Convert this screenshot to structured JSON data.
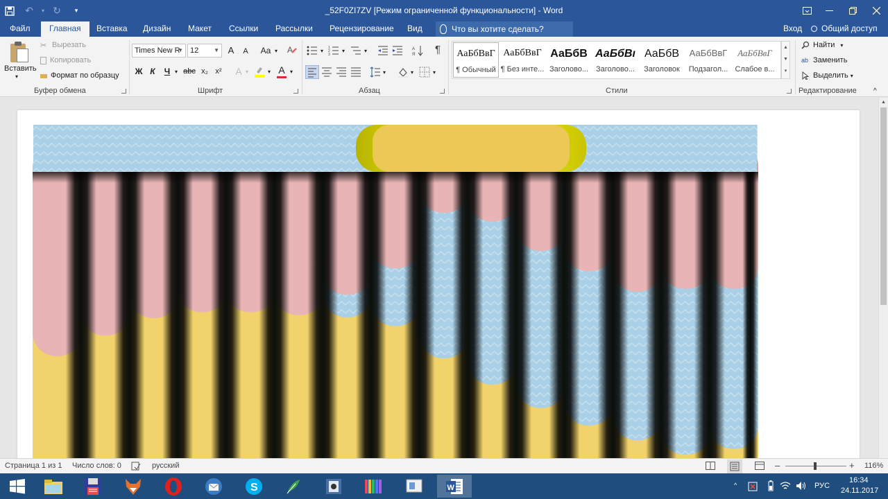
{
  "window": {
    "title": "_52F0ZI7ZV [Режим ограниченной функциональности] - Word"
  },
  "tabs": {
    "file": "Файл",
    "home": "Главная",
    "insert": "Вставка",
    "design": "Дизайн",
    "layout": "Макет",
    "references": "Ссылки",
    "mailings": "Рассылки",
    "review": "Рецензирование",
    "view": "Вид",
    "tell_me": "Что вы хотите сделать?",
    "signin": "Вход",
    "share": "Общий доступ"
  },
  "clipboard": {
    "paste": "Вставить",
    "cut": "Вырезать",
    "copy": "Копировать",
    "format_painter": "Формат по образцу",
    "label": "Буфер обмена"
  },
  "font": {
    "name": "Times New R",
    "size": "12",
    "bold": "Ж",
    "italic": "К",
    "underline": "Ч",
    "strike": "abc",
    "subscript": "x₂",
    "superscript": "x²",
    "grow": "A",
    "shrink": "A",
    "change_case": "Aa",
    "font_color_glyph": "A",
    "effects_glyph": "A",
    "label": "Шрифт"
  },
  "paragraph": {
    "label": "Абзац",
    "pilcrow": "¶"
  },
  "styles": {
    "label": "Стили",
    "items": [
      {
        "sample": "АаБбВвГ",
        "name": "¶ Обычный"
      },
      {
        "sample": "АаБбВвГ",
        "name": "¶ Без инте..."
      },
      {
        "sample": "АаБбВ",
        "name": "Заголово..."
      },
      {
        "sample": "АаБбВı",
        "name": "Заголово..."
      },
      {
        "sample": "АаБбВ",
        "name": "Заголовок"
      },
      {
        "sample": "АаБбВвГ",
        "name": "Подзагол..."
      },
      {
        "sample": "АаБбВвГ",
        "name": "Слабое в..."
      }
    ]
  },
  "editing": {
    "find": "Найти",
    "replace": "Заменить",
    "select": "Выделить",
    "label": "Редактирование"
  },
  "status": {
    "page": "Страница 1 из 1",
    "words": "Число слов: 0",
    "language": "русский",
    "zoom": "116%"
  },
  "tray": {
    "lang": "РУС",
    "time": "16:34",
    "date": "24.11.2017"
  },
  "colors": {
    "word_blue": "#2b579a",
    "stripe_pink": "#e8b4b5",
    "stripe_blue": "#a9d0e6",
    "stripe_yellow": "#f2d26b",
    "plaque_yellow": "#ecc957"
  },
  "artwork": {
    "columns": [
      {
        "pink_end": 0.63,
        "blue_end": 0.63
      },
      {
        "pink_end": 0.56,
        "blue_end": 0.56
      },
      {
        "pink_end": 0.5,
        "blue_end": 0.5
      },
      {
        "pink_end": 0.48,
        "blue_end": 0.48
      },
      {
        "pink_end": 0.48,
        "blue_end": 0.48
      },
      {
        "pink_end": 0.49,
        "blue_end": 0.49
      },
      {
        "pink_end": 0.42,
        "blue_end": 0.45
      },
      {
        "pink_end": 0.33,
        "blue_end": 0.48
      },
      {
        "pink_end": 0.14,
        "blue_end": 0.59
      },
      {
        "pink_end": 0.17,
        "blue_end": 0.68
      },
      {
        "pink_end": 0.27,
        "blue_end": 0.76
      },
      {
        "pink_end": 0.34,
        "blue_end": 0.82
      },
      {
        "pink_end": 0.41,
        "blue_end": 0.87
      },
      {
        "pink_end": 0.4,
        "blue_end": 0.92
      },
      {
        "pink_end": 0.4,
        "blue_end": 0.9
      }
    ]
  }
}
